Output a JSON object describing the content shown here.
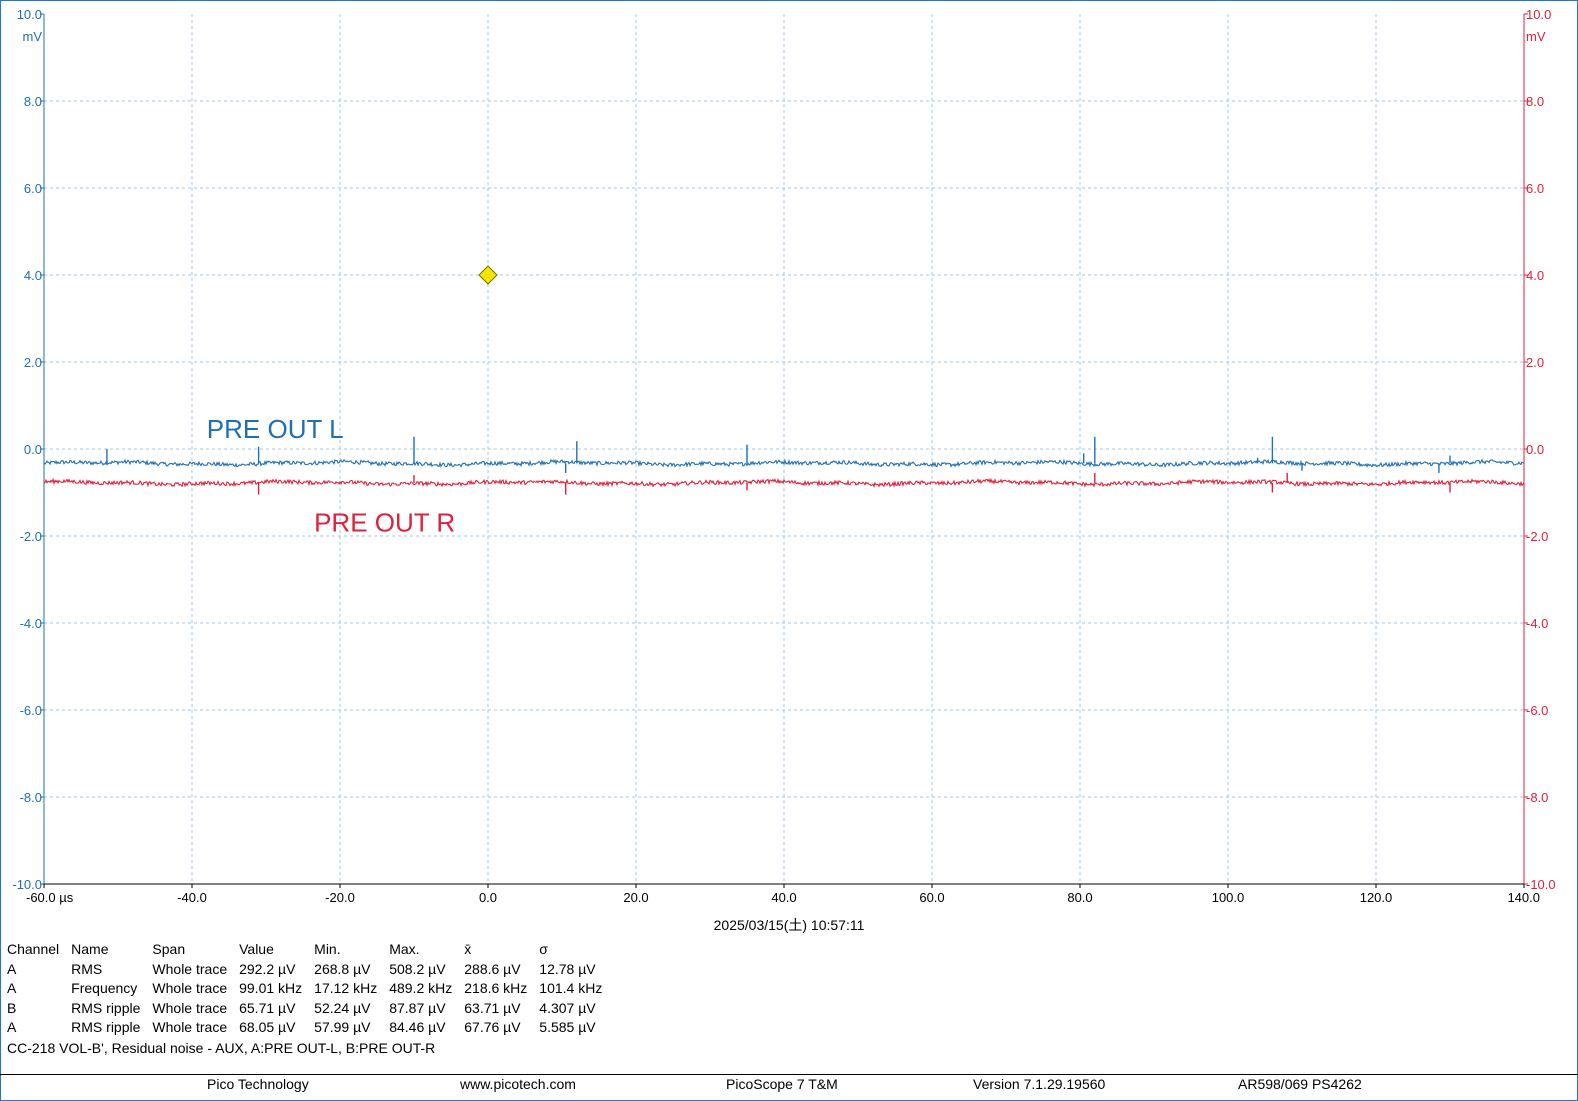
{
  "chart_data": {
    "type": "line",
    "x_axis": {
      "range": [
        -60,
        140
      ],
      "ticks": [
        -60,
        -40,
        -20,
        0,
        20,
        40,
        60,
        80,
        100,
        120,
        140
      ],
      "tick_labels": [
        "-60.0 µs",
        "-40.0",
        "-20.0",
        "0.0",
        "20.0",
        "40.0",
        "60.0",
        "80.0",
        "100.0",
        "120.0",
        "140.0"
      ],
      "unit": "µs"
    },
    "y_axis_left": {
      "range": [
        -10,
        10
      ],
      "ticks": [
        10,
        8,
        6,
        4,
        2,
        0,
        -2,
        -4,
        -6,
        -8,
        -10
      ],
      "tick_labels": [
        "10.0",
        "8.0",
        "6.0",
        "4.0",
        "2.0",
        "0.0",
        "-2.0",
        "-4.0",
        "-6.0",
        "-8.0",
        "-10.0"
      ],
      "unit": "mV",
      "color": "#1f6fb5"
    },
    "y_axis_right": {
      "range": [
        -10,
        10
      ],
      "ticks": [
        10,
        8,
        6,
        4,
        2,
        0,
        -2,
        -4,
        -6,
        -8,
        -10
      ],
      "tick_labels": [
        "10.0",
        "8.0",
        "6.0",
        "4.0",
        "2.0",
        "0.0",
        "-2.0",
        "-4.0",
        "-6.0",
        "-8.0",
        "-10.0"
      ],
      "unit": "mV",
      "color": "#e0203a"
    },
    "grid": true,
    "grid_color": "#9cc9ea",
    "trigger_marker": {
      "x": 0,
      "y": 4.0,
      "color": "#f5e400"
    },
    "series": [
      {
        "name": "PRE OUT L",
        "color": "#1f6fb5",
        "baseline": -0.33,
        "spikes": [
          {
            "x": -51.5,
            "y": 0.0
          },
          {
            "x": -31.0,
            "y": 0.05
          },
          {
            "x": -10.0,
            "y": 0.28
          },
          {
            "x": 10.5,
            "y": -0.55
          },
          {
            "x": 12.0,
            "y": 0.18
          },
          {
            "x": 35.0,
            "y": 0.1
          },
          {
            "x": 80.5,
            "y": -0.1
          },
          {
            "x": 82.0,
            "y": 0.28
          },
          {
            "x": 104.0,
            "y": -0.2
          },
          {
            "x": 106.0,
            "y": 0.28
          },
          {
            "x": 110.0,
            "y": -0.5
          },
          {
            "x": 128.5,
            "y": -0.55
          },
          {
            "x": 130.0,
            "y": -0.15
          }
        ]
      },
      {
        "name": "PRE OUT R",
        "color": "#e0203a",
        "baseline": -0.78,
        "spikes": [
          {
            "x": -31.0,
            "y": -1.05
          },
          {
            "x": -10.0,
            "y": -0.6
          },
          {
            "x": 10.5,
            "y": -1.05
          },
          {
            "x": 35.0,
            "y": -0.95
          },
          {
            "x": 82.0,
            "y": -0.55
          },
          {
            "x": 106.0,
            "y": -1.0
          },
          {
            "x": 108.0,
            "y": -0.55
          },
          {
            "x": 130.0,
            "y": -1.0
          }
        ]
      }
    ],
    "series_labels": [
      {
        "text": "PRE OUT L",
        "x": -38,
        "y": 0.25,
        "color": "#1f6fb5"
      },
      {
        "text": "PRE OUT R",
        "x": -23.5,
        "y": -1.9,
        "color": "#e0203a"
      }
    ]
  },
  "timestamp": "2025/03/15(土) 10:57:11",
  "measurements": {
    "headers": [
      "Channel",
      "Name",
      "Span",
      "Value",
      "Min.",
      "Max.",
      "x̄",
      "σ"
    ],
    "rows": [
      [
        "A",
        "RMS",
        "Whole trace",
        "292.2 µV",
        "268.8 µV",
        "508.2 µV",
        "288.6 µV",
        "12.78 µV"
      ],
      [
        "A",
        "Frequency",
        "Whole trace",
        "99.01 kHz",
        "17.12 kHz",
        "489.2 kHz",
        "218.6 kHz",
        "101.4 kHz"
      ],
      [
        "B",
        "RMS ripple",
        "Whole trace",
        "65.71 µV",
        "52.24 µV",
        "87.87 µV",
        "63.71 µV",
        "4.307 µV"
      ],
      [
        "A",
        "RMS ripple",
        "Whole trace",
        "68.05 µV",
        "57.99 µV",
        "84.46 µV",
        "67.76 µV",
        "5.585 µV"
      ]
    ]
  },
  "caption": "CC-218 VOL-B', Residual noise - AUX, A:PRE OUT-L, B:PRE OUT-R",
  "footer": {
    "company": "Pico Technology",
    "website": "www.picotech.com",
    "product": "PicoScope 7 T&M",
    "version": "Version 7.1.29.19560",
    "device": "AR598/069 PS4262"
  }
}
